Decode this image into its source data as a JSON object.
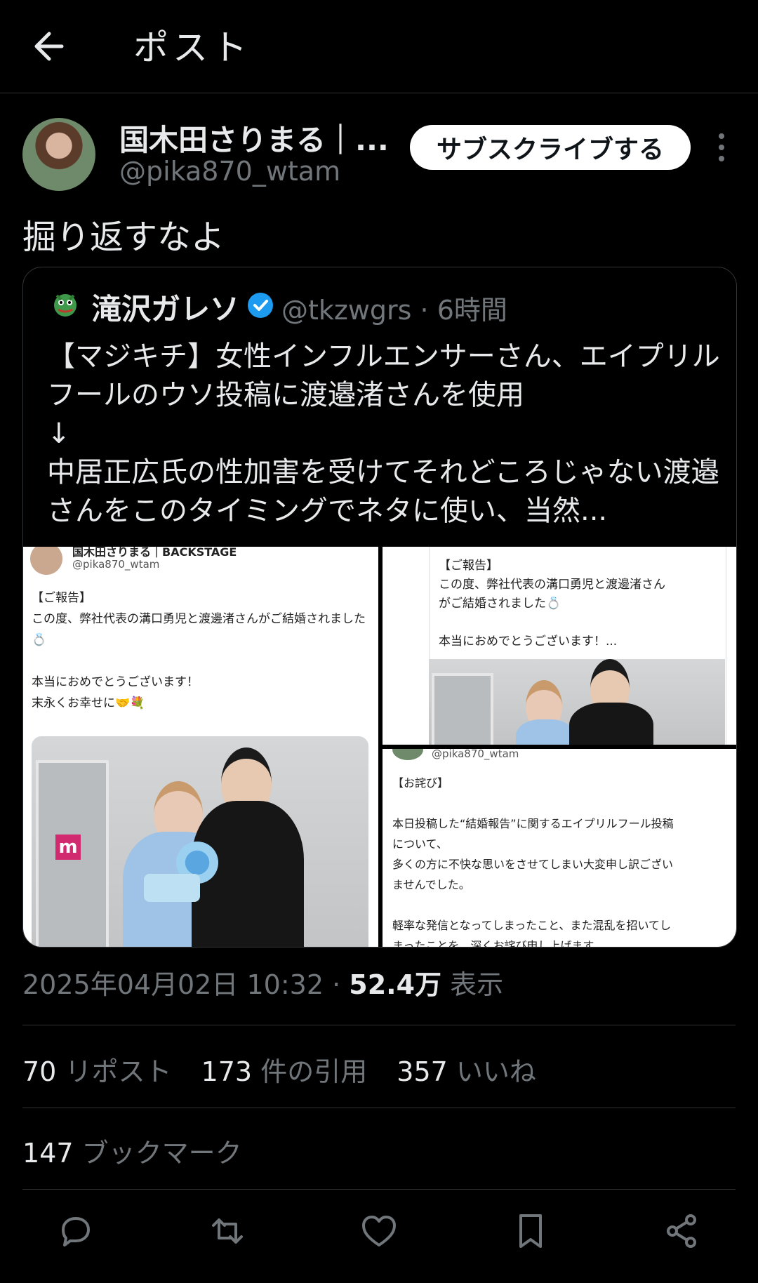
{
  "header": {
    "title": "ポスト"
  },
  "post": {
    "author_name": "国木田さりまる｜...",
    "author_handle": "@pika870_wtam",
    "subscribe_label": "サブスクライブする",
    "text": "掘り返すなよ",
    "timestamp": "2025年04月02日 10:32",
    "views_count": "52.4万",
    "views_label": "表示"
  },
  "quote": {
    "name": "滝沢ガレソ",
    "handle_time": "@tkzwgrs · 6時間",
    "text": "【マジキチ】女性インフルエンサーさん、エイプリルフールのウソ投稿に渡邉渚さんを使用\n↓\n中居正広氏の性加害を受けてそれどころじゃない渡邉さんをこのタイミングでネタに使い、当然..."
  },
  "media": {
    "m1_name": "国木田さりまる｜BACKSTAGE",
    "m1_handle": "@pika870_wtam",
    "m1_text": "【ご報告】\nこの度、弊社代表の溝口勇児と渡邊渚さんがご結婚されました💍\n\n本当におめでとうございます！\n末永くお幸せに🤝💐",
    "m1_sign": "m",
    "m2_text": "【ご報告】\nこの度、弊社代表の溝口勇児と渡邊渚さん\nがご結婚されました💍\n\n本当におめでとうございます！...",
    "m3_handle": "@pika870_wtam",
    "m3_text": "【お詫び】\n\n本日投稿した“結婚報告”に関するエイプリルフール投稿\nについて、\n多くの方に不快な思いをさせてしまい大変申し訳ござい\nませんでした。\n\n軽率な発信となってしまったこと、また混乱を招いてし\nまったことを、深くお詫び申し上げます。"
  },
  "stats": {
    "reposts_count": "70",
    "reposts_label": "リポスト",
    "quotes_count": "173",
    "quotes_label": "件の引用",
    "likes_count": "357",
    "likes_label": "いいね",
    "bookmarks_count": "147",
    "bookmarks_label": "ブックマーク"
  },
  "colors": {
    "background": "#000000",
    "text": "#e7e9ea",
    "muted": "#71767b",
    "divider": "#2f3336",
    "verified": "#1d9bf0"
  },
  "icons": [
    "back-arrow-icon",
    "more-icon",
    "verified-icon",
    "reply-icon",
    "repost-icon",
    "like-icon",
    "bookmark-icon",
    "share-icon"
  ]
}
